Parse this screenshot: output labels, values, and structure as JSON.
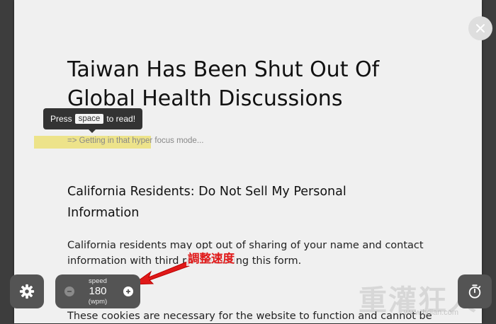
{
  "article": {
    "title": "Taiwan Has Been Shut Out Of Global Health Discussions",
    "tooltip_prefix": "Press",
    "tooltip_key": "space",
    "tooltip_suffix": "to read!",
    "hint": "=> Getting in that hyper focus mode...",
    "section_heading": "California Residents: Do Not Sell My Personal Information",
    "paragraph": "California residents may opt out of sharing of your name and contact information with third parties using this form.",
    "paragraph_2": "These cookies are necessary for the website to function and cannot be"
  },
  "annotation": {
    "label": "調整速度",
    "color": "#e01919"
  },
  "controls": {
    "speed_label": "speed",
    "speed_value": "180",
    "speed_unit": "(wpm)",
    "close_icon": "close-icon",
    "settings_icon": "gear-icon",
    "timer_icon": "stopwatch-icon"
  },
  "watermark": {
    "text": "重灌狂人",
    "url": "www.briian.com"
  },
  "colors": {
    "highlight": "#ede38a",
    "panel": "#545454",
    "backdrop": "#3d3d3d"
  }
}
